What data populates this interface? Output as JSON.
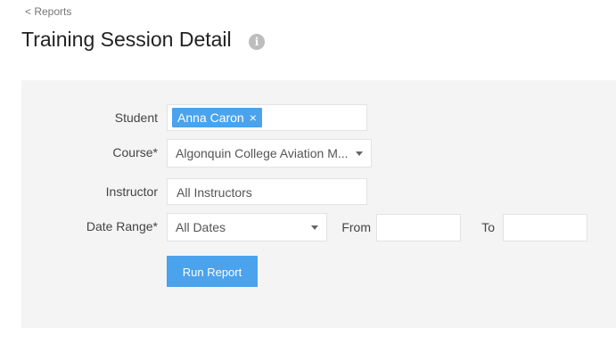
{
  "nav": {
    "back_label": "< Reports"
  },
  "header": {
    "title": "Training Session Detail",
    "info_icon": "i"
  },
  "form": {
    "student": {
      "label": "Student",
      "chip": "Anna Caron",
      "chip_remove": "×"
    },
    "course": {
      "label": "Course*",
      "value": "Algonquin College Aviation M..."
    },
    "instructor": {
      "label": "Instructor",
      "placeholder": "All Instructors"
    },
    "date_range": {
      "label": "Date Range*",
      "value": "All Dates"
    },
    "from": {
      "label": "From",
      "value": ""
    },
    "to": {
      "label": "To",
      "value": ""
    },
    "run_label": "Run Report"
  },
  "colors": {
    "accent": "#4aa3ec",
    "panel_bg": "#f4f4f4"
  }
}
